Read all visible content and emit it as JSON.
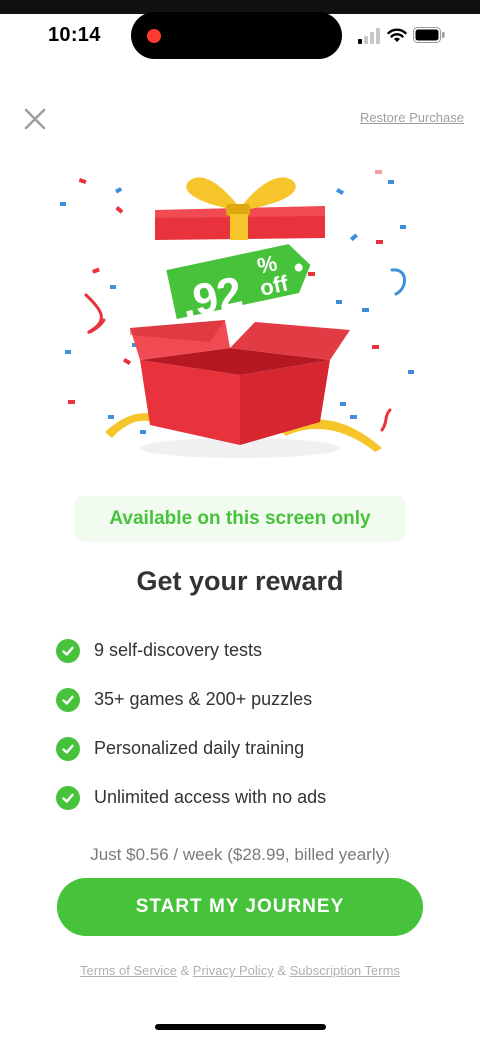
{
  "status": {
    "time": "10:14"
  },
  "header": {
    "restore_label": "Restore Purchase"
  },
  "hero": {
    "discount_number": ".92",
    "discount_percent": "%",
    "discount_off": "off"
  },
  "badge": {
    "label": "Available on this screen only"
  },
  "headline": "Get your reward",
  "features": [
    {
      "text": "9 self-discovery tests"
    },
    {
      "text": "35+ games & 200+ puzzles"
    },
    {
      "text": "Personalized daily training"
    },
    {
      "text": "Unlimited access with no ads"
    }
  ],
  "price_text": "Just $0.56 / week ($28.99, billed yearly)",
  "cta_label": "START MY JOURNEY",
  "footer": {
    "terms": "Terms of Service",
    "sep1": "&",
    "privacy": "Privacy Policy",
    "sep2": "&",
    "subscription": "Subscription Terms"
  },
  "colors": {
    "accent": "#47c23b",
    "box_red": "#e8323c",
    "ribbon_yellow": "#f6c52b"
  }
}
